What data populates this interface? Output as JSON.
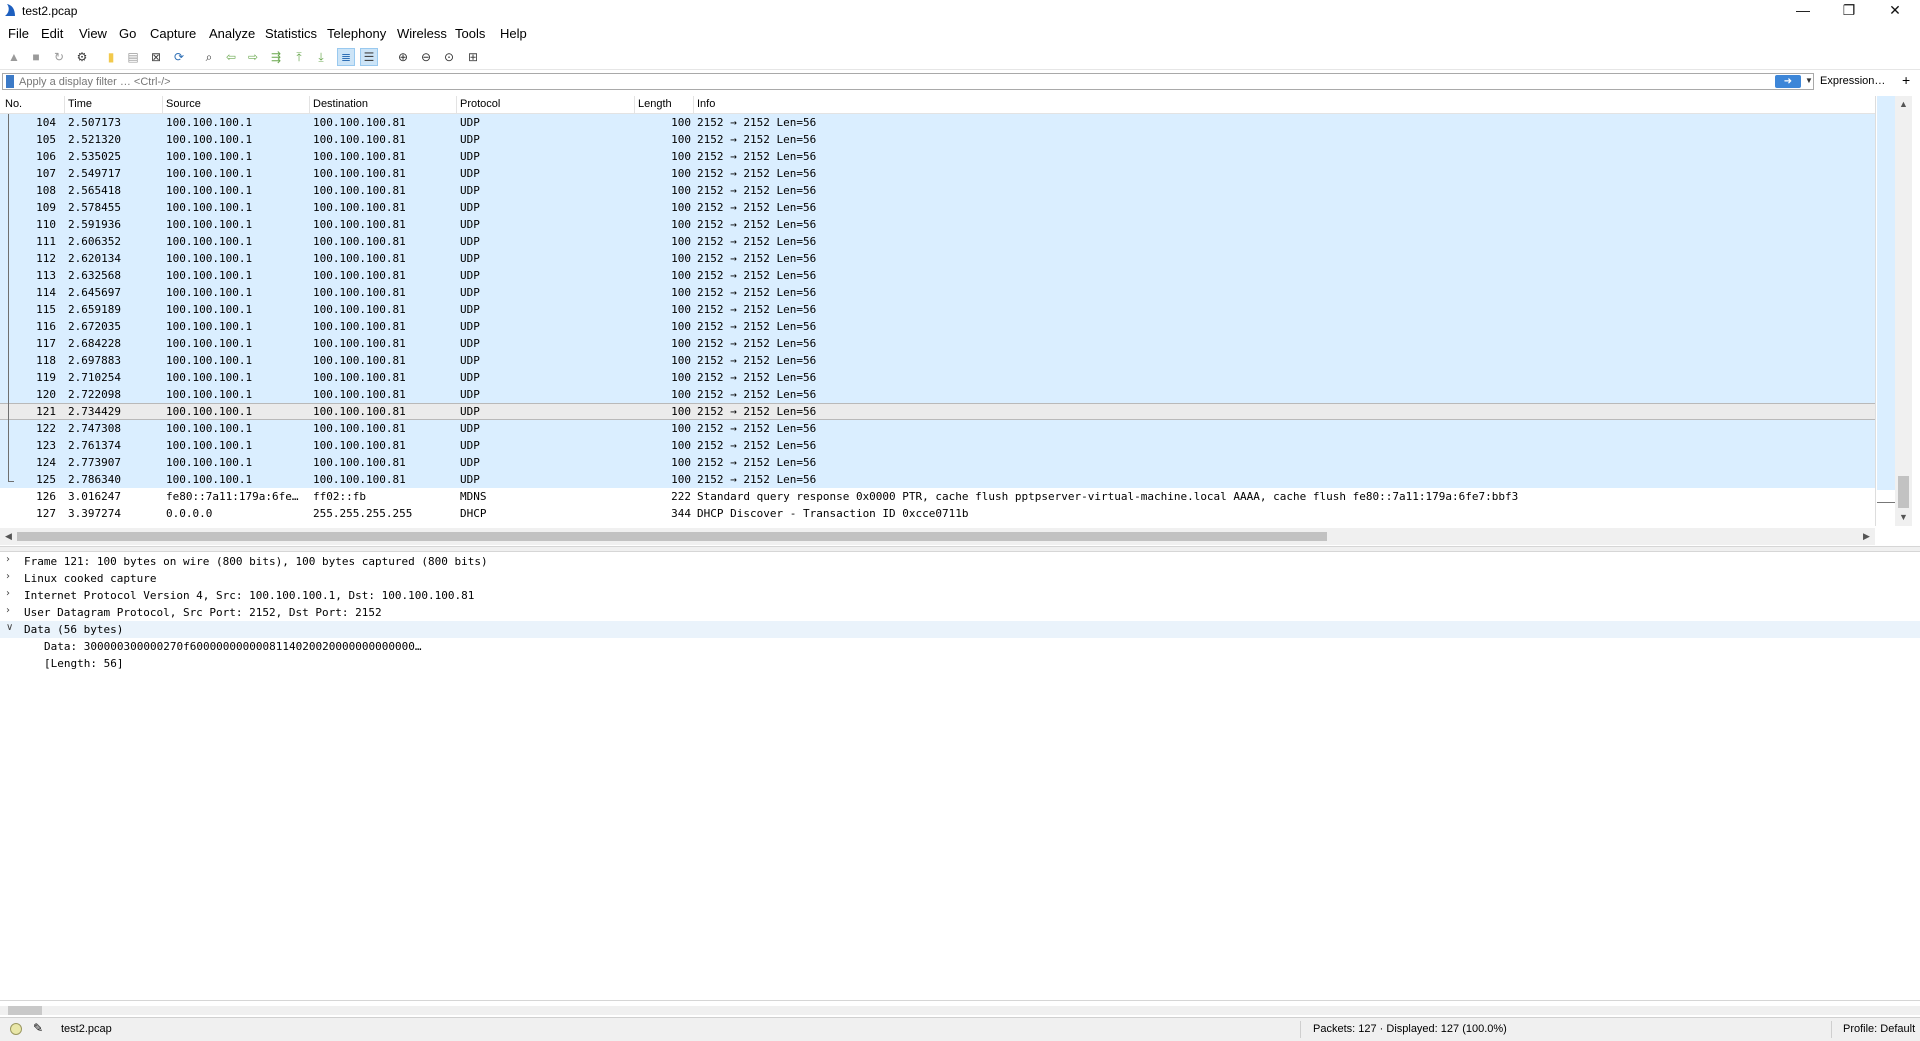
{
  "window": {
    "title": "test2.pcap",
    "app_icon": "wireshark-fin-icon"
  },
  "menu": [
    "File",
    "Edit",
    "View",
    "Go",
    "Capture",
    "Analyze",
    "Statistics",
    "Telephony",
    "Wireless",
    "Tools",
    "Help"
  ],
  "toolbar": [
    {
      "name": "start-capture-icon",
      "glyph": "▲",
      "color": "#9a9a9a"
    },
    {
      "name": "stop-capture-icon",
      "glyph": "■",
      "color": "#9a9a9a"
    },
    {
      "name": "restart-capture-icon",
      "glyph": "↻",
      "color": "#9a9a9a"
    },
    {
      "name": "capture-options-icon",
      "glyph": "⚙",
      "color": "#333333"
    },
    {
      "name": "open-file-icon",
      "glyph": "▮",
      "color": "#f2c94c"
    },
    {
      "name": "save-file-icon",
      "glyph": "▤",
      "color": "#9a9a9a"
    },
    {
      "name": "close-file-icon",
      "glyph": "⊠",
      "color": "#444444"
    },
    {
      "name": "reload-file-icon",
      "glyph": "⟳",
      "color": "#2f6fb5"
    },
    {
      "name": "find-packet-icon",
      "glyph": "⌕",
      "color": "#333333"
    },
    {
      "name": "go-back-icon",
      "glyph": "⇦",
      "color": "#6aa84f"
    },
    {
      "name": "go-forward-icon",
      "glyph": "⇨",
      "color": "#6aa84f"
    },
    {
      "name": "go-to-packet-icon",
      "glyph": "⇶",
      "color": "#6aa84f"
    },
    {
      "name": "first-packet-icon",
      "glyph": "⤒",
      "color": "#6aa84f"
    },
    {
      "name": "last-packet-icon",
      "glyph": "⤓",
      "color": "#6aa84f"
    },
    {
      "name": "auto-scroll-icon",
      "glyph": "≣",
      "color": "#2f6fb5",
      "pressed": true
    },
    {
      "name": "colorize-icon",
      "glyph": "☰",
      "color": "#444444",
      "pressed": true
    },
    {
      "name": "zoom-in-icon",
      "glyph": "⊕",
      "color": "#333333"
    },
    {
      "name": "zoom-out-icon",
      "glyph": "⊖",
      "color": "#333333"
    },
    {
      "name": "normal-size-icon",
      "glyph": "⊙",
      "color": "#333333"
    },
    {
      "name": "resize-columns-icon",
      "glyph": "⊞",
      "color": "#444444"
    }
  ],
  "filter": {
    "placeholder": "Apply a display filter … <Ctrl-/>",
    "expression_label": "Expression…",
    "add_label": "+"
  },
  "columns": [
    "No.",
    "Time",
    "Source",
    "Destination",
    "Protocol",
    "Length",
    "Info"
  ],
  "packets": [
    {
      "no": "104",
      "time": "2.507173",
      "src": "100.100.100.1",
      "dst": "100.100.100.81",
      "proto": "UDP",
      "len": "100",
      "info": "2152 → 2152 Len=56"
    },
    {
      "no": "105",
      "time": "2.521320",
      "src": "100.100.100.1",
      "dst": "100.100.100.81",
      "proto": "UDP",
      "len": "100",
      "info": "2152 → 2152 Len=56"
    },
    {
      "no": "106",
      "time": "2.535025",
      "src": "100.100.100.1",
      "dst": "100.100.100.81",
      "proto": "UDP",
      "len": "100",
      "info": "2152 → 2152 Len=56"
    },
    {
      "no": "107",
      "time": "2.549717",
      "src": "100.100.100.1",
      "dst": "100.100.100.81",
      "proto": "UDP",
      "len": "100",
      "info": "2152 → 2152 Len=56"
    },
    {
      "no": "108",
      "time": "2.565418",
      "src": "100.100.100.1",
      "dst": "100.100.100.81",
      "proto": "UDP",
      "len": "100",
      "info": "2152 → 2152 Len=56"
    },
    {
      "no": "109",
      "time": "2.578455",
      "src": "100.100.100.1",
      "dst": "100.100.100.81",
      "proto": "UDP",
      "len": "100",
      "info": "2152 → 2152 Len=56"
    },
    {
      "no": "110",
      "time": "2.591936",
      "src": "100.100.100.1",
      "dst": "100.100.100.81",
      "proto": "UDP",
      "len": "100",
      "info": "2152 → 2152 Len=56"
    },
    {
      "no": "111",
      "time": "2.606352",
      "src": "100.100.100.1",
      "dst": "100.100.100.81",
      "proto": "UDP",
      "len": "100",
      "info": "2152 → 2152 Len=56"
    },
    {
      "no": "112",
      "time": "2.620134",
      "src": "100.100.100.1",
      "dst": "100.100.100.81",
      "proto": "UDP",
      "len": "100",
      "info": "2152 → 2152 Len=56"
    },
    {
      "no": "113",
      "time": "2.632568",
      "src": "100.100.100.1",
      "dst": "100.100.100.81",
      "proto": "UDP",
      "len": "100",
      "info": "2152 → 2152 Len=56"
    },
    {
      "no": "114",
      "time": "2.645697",
      "src": "100.100.100.1",
      "dst": "100.100.100.81",
      "proto": "UDP",
      "len": "100",
      "info": "2152 → 2152 Len=56"
    },
    {
      "no": "115",
      "time": "2.659189",
      "src": "100.100.100.1",
      "dst": "100.100.100.81",
      "proto": "UDP",
      "len": "100",
      "info": "2152 → 2152 Len=56"
    },
    {
      "no": "116",
      "time": "2.672035",
      "src": "100.100.100.1",
      "dst": "100.100.100.81",
      "proto": "UDP",
      "len": "100",
      "info": "2152 → 2152 Len=56"
    },
    {
      "no": "117",
      "time": "2.684228",
      "src": "100.100.100.1",
      "dst": "100.100.100.81",
      "proto": "UDP",
      "len": "100",
      "info": "2152 → 2152 Len=56"
    },
    {
      "no": "118",
      "time": "2.697883",
      "src": "100.100.100.1",
      "dst": "100.100.100.81",
      "proto": "UDP",
      "len": "100",
      "info": "2152 → 2152 Len=56"
    },
    {
      "no": "119",
      "time": "2.710254",
      "src": "100.100.100.1",
      "dst": "100.100.100.81",
      "proto": "UDP",
      "len": "100",
      "info": "2152 → 2152 Len=56"
    },
    {
      "no": "120",
      "time": "2.722098",
      "src": "100.100.100.1",
      "dst": "100.100.100.81",
      "proto": "UDP",
      "len": "100",
      "info": "2152 → 2152 Len=56"
    },
    {
      "no": "121",
      "time": "2.734429",
      "src": "100.100.100.1",
      "dst": "100.100.100.81",
      "proto": "UDP",
      "len": "100",
      "info": "2152 → 2152 Len=56",
      "selected": true
    },
    {
      "no": "122",
      "time": "2.747308",
      "src": "100.100.100.1",
      "dst": "100.100.100.81",
      "proto": "UDP",
      "len": "100",
      "info": "2152 → 2152 Len=56"
    },
    {
      "no": "123",
      "time": "2.761374",
      "src": "100.100.100.1",
      "dst": "100.100.100.81",
      "proto": "UDP",
      "len": "100",
      "info": "2152 → 2152 Len=56"
    },
    {
      "no": "124",
      "time": "2.773907",
      "src": "100.100.100.1",
      "dst": "100.100.100.81",
      "proto": "UDP",
      "len": "100",
      "info": "2152 → 2152 Len=56"
    },
    {
      "no": "125",
      "time": "2.786340",
      "src": "100.100.100.1",
      "dst": "100.100.100.81",
      "proto": "UDP",
      "len": "100",
      "info": "2152 → 2152 Len=56"
    },
    {
      "no": "126",
      "time": "3.016247",
      "src": "fe80::7a11:179a:6fe…",
      "dst": "ff02::fb",
      "proto": "MDNS",
      "len": "222",
      "info": "Standard query response 0x0000 PTR, cache flush pptpserver-virtual-machine.local AAAA, cache flush fe80::7a11:179a:6fe7:bbf3"
    },
    {
      "no": "127",
      "time": "3.397274",
      "src": "0.0.0.0",
      "dst": "255.255.255.255",
      "proto": "DHCP",
      "len": "344",
      "info": "DHCP Discover - Transaction ID 0xcce0711b"
    }
  ],
  "details": [
    {
      "text": "Frame 121: 100 bytes on wire (800 bits), 100 bytes captured (800 bits)",
      "expanded": false,
      "indent": 0
    },
    {
      "text": "Linux cooked capture",
      "expanded": false,
      "indent": 0
    },
    {
      "text": "Internet Protocol Version 4, Src: 100.100.100.1, Dst: 100.100.100.81",
      "expanded": false,
      "indent": 0
    },
    {
      "text": "User Datagram Protocol, Src Port: 2152, Dst Port: 2152",
      "expanded": false,
      "indent": 0
    },
    {
      "text": "Data (56 bytes)",
      "expanded": true,
      "indent": 0
    },
    {
      "text": "Data: 300000300000270f6000000000008114020020000000000000…",
      "indent": 1
    },
    {
      "text": "[Length: 56]",
      "indent": 1
    }
  ],
  "status": {
    "file": "test2.pcap",
    "packets": "Packets: 127 · Displayed: 127 (100.0%)",
    "profile": "Profile: Default"
  },
  "colors": {
    "udp_row": "#daeeff",
    "selected_row": "#ebebeb"
  }
}
